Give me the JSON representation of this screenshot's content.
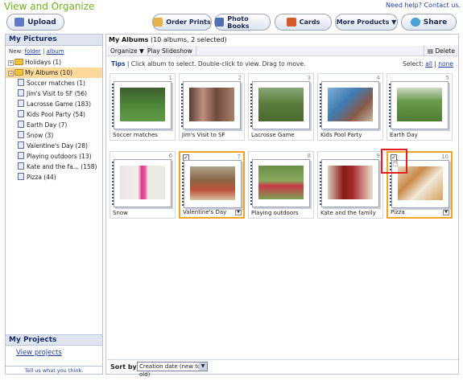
{
  "header": {
    "title": "View and Organize",
    "help_text": "Need help?",
    "contact_text": "Contact us."
  },
  "toolbar_top": {
    "upload": "Upload",
    "order_prints": "Order Prints",
    "photo_books": "Photo Books",
    "cards": "Cards",
    "more_products": "More Products ▼",
    "share": "Share"
  },
  "sidebar": {
    "title": "My Pictures",
    "new_label": "New:",
    "new_folder": "folder",
    "new_album": "album",
    "holidays": "Holidays (1)",
    "my_albums": "My Albums (10)",
    "items": [
      "Soccer matches (1)",
      "Jim's Visit to SF (56)",
      "Lacrosse Game (183)",
      "Kids Pool Party (54)",
      "Earth Day (7)",
      "Snow (3)",
      "Valentine's Day (28)",
      "Playing outdoors (13)",
      "Kate and the fa... (158)",
      "Pizza (44)"
    ],
    "projects_title": "My Projects",
    "view_projects": "View projects",
    "tell_us": "Tell us what you think."
  },
  "main": {
    "title": "My Albums",
    "subtitle": "(10 albums, 2 selected)",
    "organize": "Organize ▼",
    "play_slideshow": "Play Slideshow",
    "delete": "Delete",
    "tips_label": "Tips",
    "tips_text": "| Click album to select. Double-click to view. Drag to move.",
    "select_label": "Select:",
    "select_all": "all",
    "select_none": "none",
    "albums": [
      {
        "num": "1",
        "name": "Soccer matches"
      },
      {
        "num": "2",
        "name": "Jim's Visit to SF"
      },
      {
        "num": "3",
        "name": "Lacrosse Game"
      },
      {
        "num": "4",
        "name": "Kids Pool Party"
      },
      {
        "num": "5",
        "name": "Earth Day"
      },
      {
        "num": "6",
        "name": "Snow"
      },
      {
        "num": "7",
        "name": "Valentine's Day"
      },
      {
        "num": "8",
        "name": "Playing outdoors"
      },
      {
        "num": "9",
        "name": "Kate and the family"
      },
      {
        "num": "10",
        "name": "Pizza"
      }
    ],
    "sort_label": "Sort by:",
    "sort_value": "Creation date (new to old)"
  },
  "colors": {
    "accent_green": "#6fae1e",
    "selection_orange": "#f0a423",
    "highlight_red": "#e02020"
  }
}
